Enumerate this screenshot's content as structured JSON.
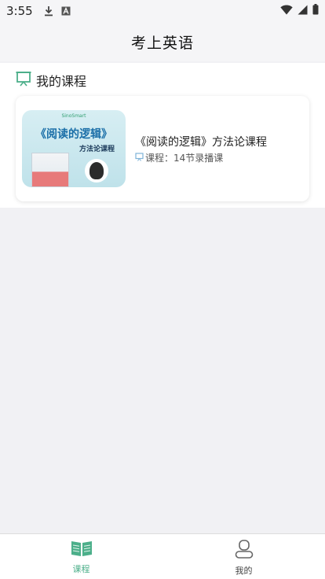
{
  "status_bar": {
    "time": "3:55",
    "icons": [
      "download-icon",
      "keyboard-a-icon",
      "wifi-icon",
      "signal-icon",
      "battery-icon"
    ]
  },
  "header": {
    "title": "考上英语"
  },
  "section": {
    "title": "我的课程",
    "icon": "blackboard-icon"
  },
  "course": {
    "thumbnail": {
      "brand": "SinoSmart",
      "headline": "《阅读的逻辑》",
      "subline": "方法论课程"
    },
    "title": "《阅读的逻辑》方法论课程",
    "meta": "课程：14节录播课"
  },
  "tabbar": {
    "tabs": [
      {
        "label": "课程",
        "icon": "open-book-icon",
        "active": true
      },
      {
        "label": "我的",
        "icon": "person-icon",
        "active": false
      }
    ]
  },
  "colors": {
    "accent": "#4caf8a",
    "background": "#f1f1f4"
  }
}
